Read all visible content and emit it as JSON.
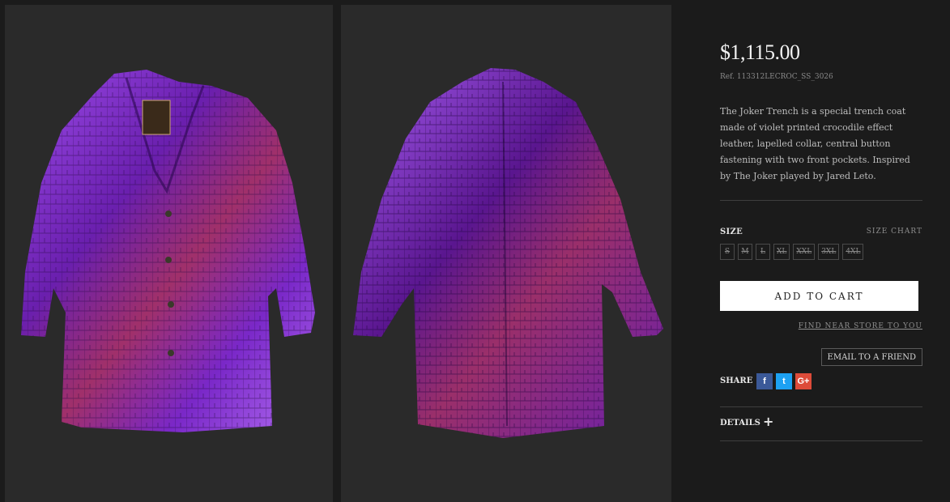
{
  "product": {
    "price": "$1,115.00",
    "ref": "Ref. 113312LECROC_SS_3026",
    "description": "The Joker Trench is a special trench coat made of violet printed crocodile effect leather, lapelled collar, central button fastening with two front pockets. Inspired by The Joker played by Jared Leto.",
    "images": {
      "front_alt": "Purple crocodile effect leather trench coat, front view",
      "back_alt": "Purple crocodile effect leather trench coat, back view"
    },
    "colors": {
      "coat": "#8a2fd0",
      "panel_bg": "#2a2a2a"
    }
  },
  "size": {
    "label": "SIZE",
    "chart_link": "SIZE CHART",
    "options": [
      "S",
      "M",
      "L",
      "XL",
      "XXL",
      "3XL",
      "4XL"
    ]
  },
  "actions": {
    "add_to_cart": "ADD TO CART",
    "find_store": "FIND NEAR STORE TO YOU",
    "email_friend": "EMAIL TO A FRIEND"
  },
  "share": {
    "label": "SHARE",
    "icons": [
      {
        "name": "facebook-icon",
        "glyph": "f",
        "color": "#3b5998"
      },
      {
        "name": "twitter-icon",
        "glyph": "t",
        "color": "#1da1f2"
      },
      {
        "name": "google-plus-icon",
        "glyph": "G+",
        "color": "#dd4b39"
      }
    ]
  },
  "details": {
    "label": "DETAILS",
    "toggle": "+"
  }
}
